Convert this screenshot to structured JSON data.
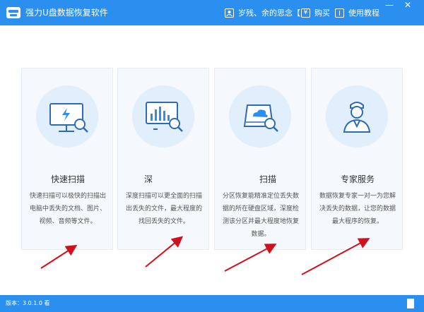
{
  "window": {
    "title": "强力U盘数据恢复软件",
    "minimize": "—",
    "close": "✕"
  },
  "toolbar": {
    "user_label": "岁残、余的思念【",
    "buy_label": "购买",
    "tutorial_label": "使用教程"
  },
  "cards": [
    {
      "icon": "monitor-lightning-search-icon",
      "title": "快速扫描",
      "description": "快速扫描可以极快的扫描出电脑中丢失的文档、图片、视频、音频等文件。"
    },
    {
      "icon": "chart-search-icon",
      "title": "深",
      "description": "深度扫描可以更全面的扫描出丢失的文件，最大程度的找回丢失的文件。"
    },
    {
      "icon": "disk-cloud-search-icon",
      "title": "扫描",
      "description": "分区恢复能精准定位丢失数据的所在硬盘区域，深度检测该分区并最大程度地恢复数据。"
    },
    {
      "icon": "expert-person-icon",
      "title": "专家服务",
      "description": "数据恢复专家一对一为您解决丢失的数据，让您的数据最大程序的恢复。"
    }
  ],
  "status": {
    "version": "版本：3.0.1.0 看"
  },
  "colors": {
    "accent": "#2b8ff0",
    "card_bg": "#f5f8fd",
    "icon_circle": "#e1eefb",
    "annotation_arrow": "#d0101a"
  }
}
